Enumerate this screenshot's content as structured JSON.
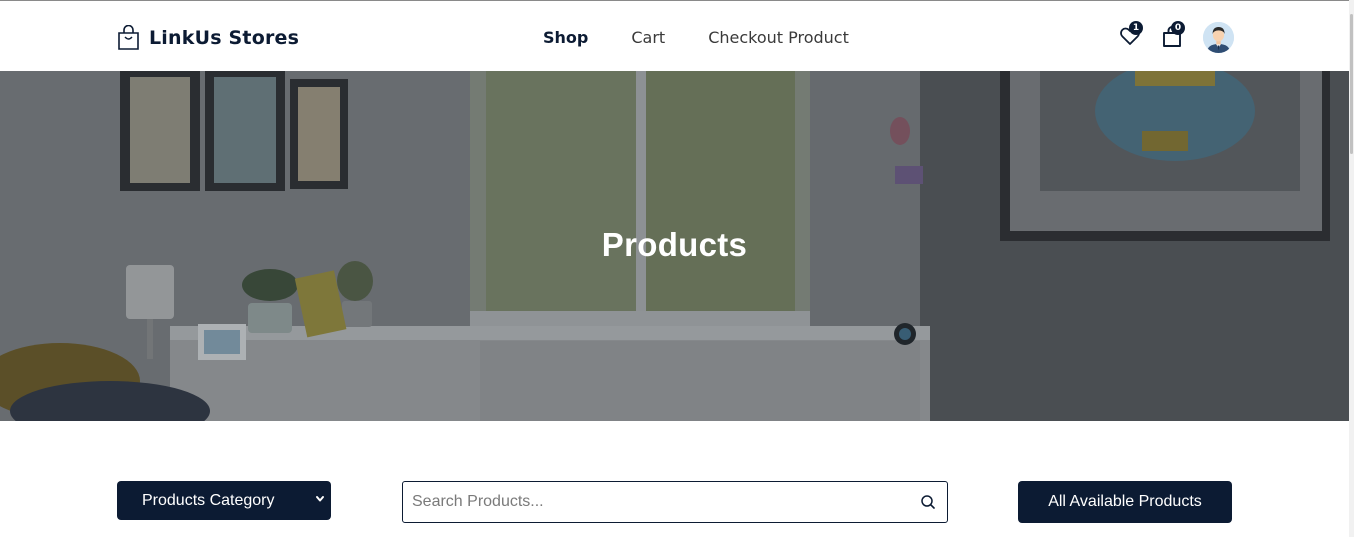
{
  "navbar": {
    "brand": "LinkUs Stores",
    "links": {
      "shop": "Shop",
      "cart": "Cart",
      "checkout": "Checkout Product"
    },
    "wishlist_count": "1",
    "cart_count": "0"
  },
  "hero": {
    "title": "Products"
  },
  "filters": {
    "category_label": "Products Category",
    "search_placeholder": "Search Products...",
    "all_products_label": "All Available Products"
  },
  "colors": {
    "primary": "#0c1b33",
    "hero_overlay": "#5f6468"
  },
  "icons": {
    "brand": "shopping-bag-icon",
    "wishlist": "heart-icon",
    "cart": "shopping-bag-icon",
    "avatar": "user-avatar",
    "category": "chevron-down-icon",
    "search": "search-icon"
  }
}
